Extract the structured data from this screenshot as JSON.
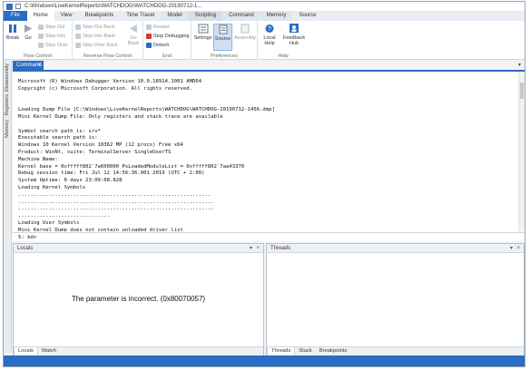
{
  "window": {
    "title": "C:\\Windows\\LiveKernelReports\\WATCHDOG\\WATCHDOG-20190712-1..."
  },
  "ribbon_tabs": [
    {
      "label": "File"
    },
    {
      "label": "Home"
    },
    {
      "label": "View"
    },
    {
      "label": "Breakpoints"
    },
    {
      "label": "Time Travel"
    },
    {
      "label": "Model"
    },
    {
      "label": "Scripting"
    },
    {
      "label": "Command"
    },
    {
      "label": "Memory"
    },
    {
      "label": "Source"
    }
  ],
  "ribbon": {
    "flow_control": {
      "label": "Flow Control",
      "break": "Break",
      "go": "Go",
      "step_out": "Step Out",
      "step_into": "Step Into",
      "step_over": "Step Over"
    },
    "reverse_flow": {
      "label": "Reverse Flow Control",
      "step_out_back": "Step Out Back",
      "step_into_back": "Step Into Back",
      "step_over_back": "Step Over Back",
      "go_back_1": "Go",
      "go_back_2": "Back"
    },
    "end": {
      "label": "End",
      "restart": "Restart",
      "stop_debugging": "Stop Debugging",
      "detach": "Detach"
    },
    "preferences": {
      "label": "Preferences",
      "settings": "Settings",
      "source": "Source",
      "assembly": "Assembly"
    },
    "help": {
      "label": "Help",
      "local_help_1": "Local",
      "local_help_2": "Help",
      "feedback_hub_1": "Feedback",
      "feedback_hub_2": "Hub"
    }
  },
  "side_tabs": [
    "Disassembly",
    "Registers",
    "Memory"
  ],
  "command_tab": {
    "label": "Command",
    "output": "Microsoft (R) Windows Debugger Version 10.0.18914.1001 AMD64\nCopyright (c) Microsoft Corporation. All rights reserved.\n\n\nLoading Dump File [C:\\Windows\\LiveKernelReports\\WATCHDOG\\WATCHDOG-20190712-1456.dmp]\nMini Kernel Dump File: Only registers and stack trace are available\n\nSymbol search path is: srv*\nExecutable search path is:\nWindows 10 Kernel Version 18362 MP (12 procs) Free x64\nProduct: WinNt, suite: TerminalServer SingleUserTS\nMachine Name:\nKernel base = 0xfffff802`7a600000 PsLoadedModuleList = 0xfffff802`7aa43370\nDebug session time: Fri Jul 12 14:56:36.001 2019 (UTC + 2:00)\nSystem Uptime: 0 days 23:09:08.828\nLoading Kernel Symbols\n...............................................................\n................................................................\n................................................................\n..............................\nLoading User Symbols\nMini Kernel Dump does not contain unloaded driver list",
    "prompt": "5: kd>",
    "input_value": ""
  },
  "locals_panel": {
    "title": "Locals",
    "message": "The parameter is incorrect. (0x80070057)",
    "tabs": [
      "Locals",
      "Watch"
    ]
  },
  "threads_panel": {
    "title": "Threads",
    "tabs": [
      "Threads",
      "Stack",
      "Breakpoints"
    ]
  },
  "colors": {
    "accent": "#2b6cc4",
    "status_bar": "#2b6cc4"
  }
}
